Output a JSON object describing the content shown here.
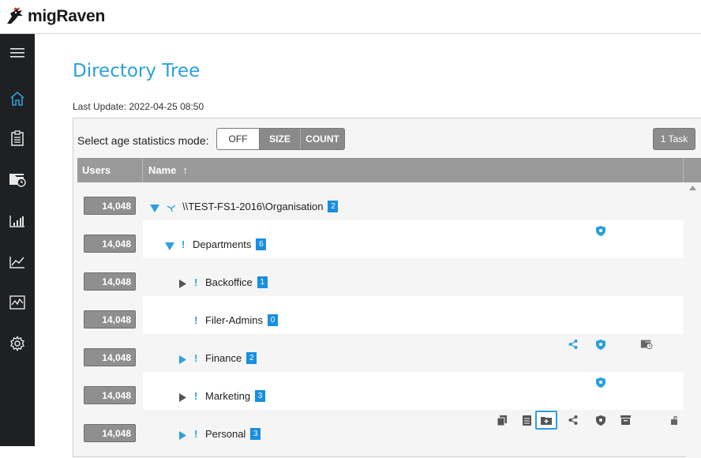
{
  "app": {
    "name": "migRaven"
  },
  "sidebar": {
    "items": [
      {
        "icon": "hamburger-icon"
      },
      {
        "icon": "home-icon",
        "active": true
      },
      {
        "icon": "clipboard-icon"
      },
      {
        "icon": "folder-clock-icon"
      },
      {
        "icon": "bar-chart-icon"
      },
      {
        "icon": "line-chart-icon"
      },
      {
        "icon": "activity-chart-icon"
      },
      {
        "icon": "gear-icon"
      }
    ]
  },
  "page": {
    "title": "Directory Tree",
    "last_update": "Last Update: 2022-04-25 08:50"
  },
  "toolbar": {
    "age_label": "Select age statistics mode:",
    "modes": [
      "OFF",
      "SIZE",
      "COUNT"
    ],
    "selected_mode": "OFF",
    "task_button": "1 Task"
  },
  "table": {
    "columns": {
      "users": "Users",
      "name": "Name",
      "sort_glyph": "↑"
    },
    "rows": [
      {
        "users": "14,048",
        "name": "\\\\TEST-FS1-2016\\Organisation",
        "count": "2",
        "level": 0,
        "expander": "expanded",
        "marker": "share-root"
      },
      {
        "users": "14,048",
        "name": "Departments",
        "count": "6",
        "level": 1,
        "expander": "expanded",
        "marker": "!"
      },
      {
        "users": "14,048",
        "name": "Backoffice",
        "count": "1",
        "level": 2,
        "expander": "collapsed-gray",
        "marker": "!"
      },
      {
        "users": "14,048",
        "name": "Filer-Admins",
        "count": "0",
        "level": 2,
        "expander": "none",
        "marker": "!"
      },
      {
        "users": "14,048",
        "name": "Finance",
        "count": "2",
        "level": 2,
        "expander": "collapsed-blue",
        "marker": "!"
      },
      {
        "users": "14,048",
        "name": "Marketing",
        "count": "3",
        "level": 2,
        "expander": "collapsed-gray",
        "marker": "!"
      },
      {
        "users": "14,048",
        "name": "Personal",
        "count": "3",
        "level": 2,
        "expander": "collapsed-blue",
        "marker": "!"
      }
    ]
  },
  "colors": {
    "accent": "#2aa0dd",
    "count_badge": "#1a8fe0",
    "sidebar_bg": "#1f2022",
    "header_gray": "#9a9a9a"
  }
}
